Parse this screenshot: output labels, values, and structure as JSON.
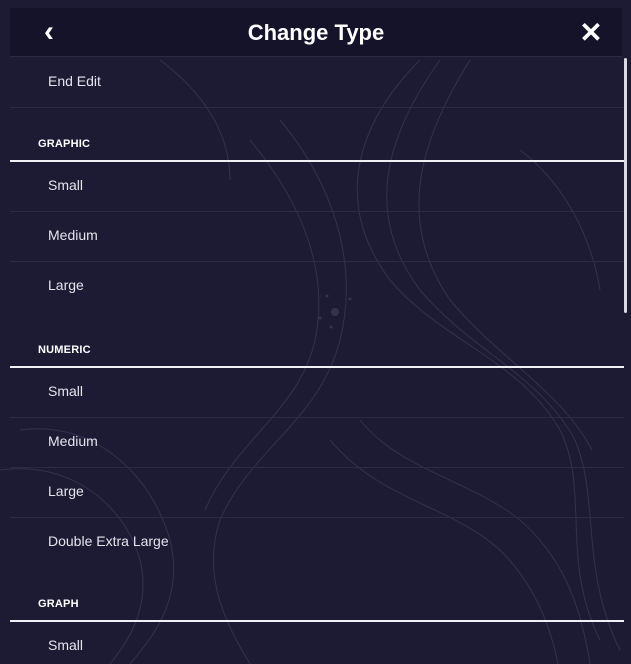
{
  "header": {
    "back_icon": "chevron-left-icon",
    "title": "Change Type",
    "close_icon": "close-icon"
  },
  "menu": {
    "end_edit": "End Edit",
    "sections": [
      {
        "label": "GRAPHIC",
        "items": [
          "Small",
          "Medium",
          "Large"
        ]
      },
      {
        "label": "NUMERIC",
        "items": [
          "Small",
          "Medium",
          "Large",
          "Double Extra Large"
        ]
      },
      {
        "label": "GRAPH",
        "items": [
          "Small"
        ]
      }
    ]
  },
  "colors": {
    "background": "#1d1b34",
    "header": "#151329",
    "text": "#e4e4ec",
    "divider": "#f0f0f4"
  }
}
